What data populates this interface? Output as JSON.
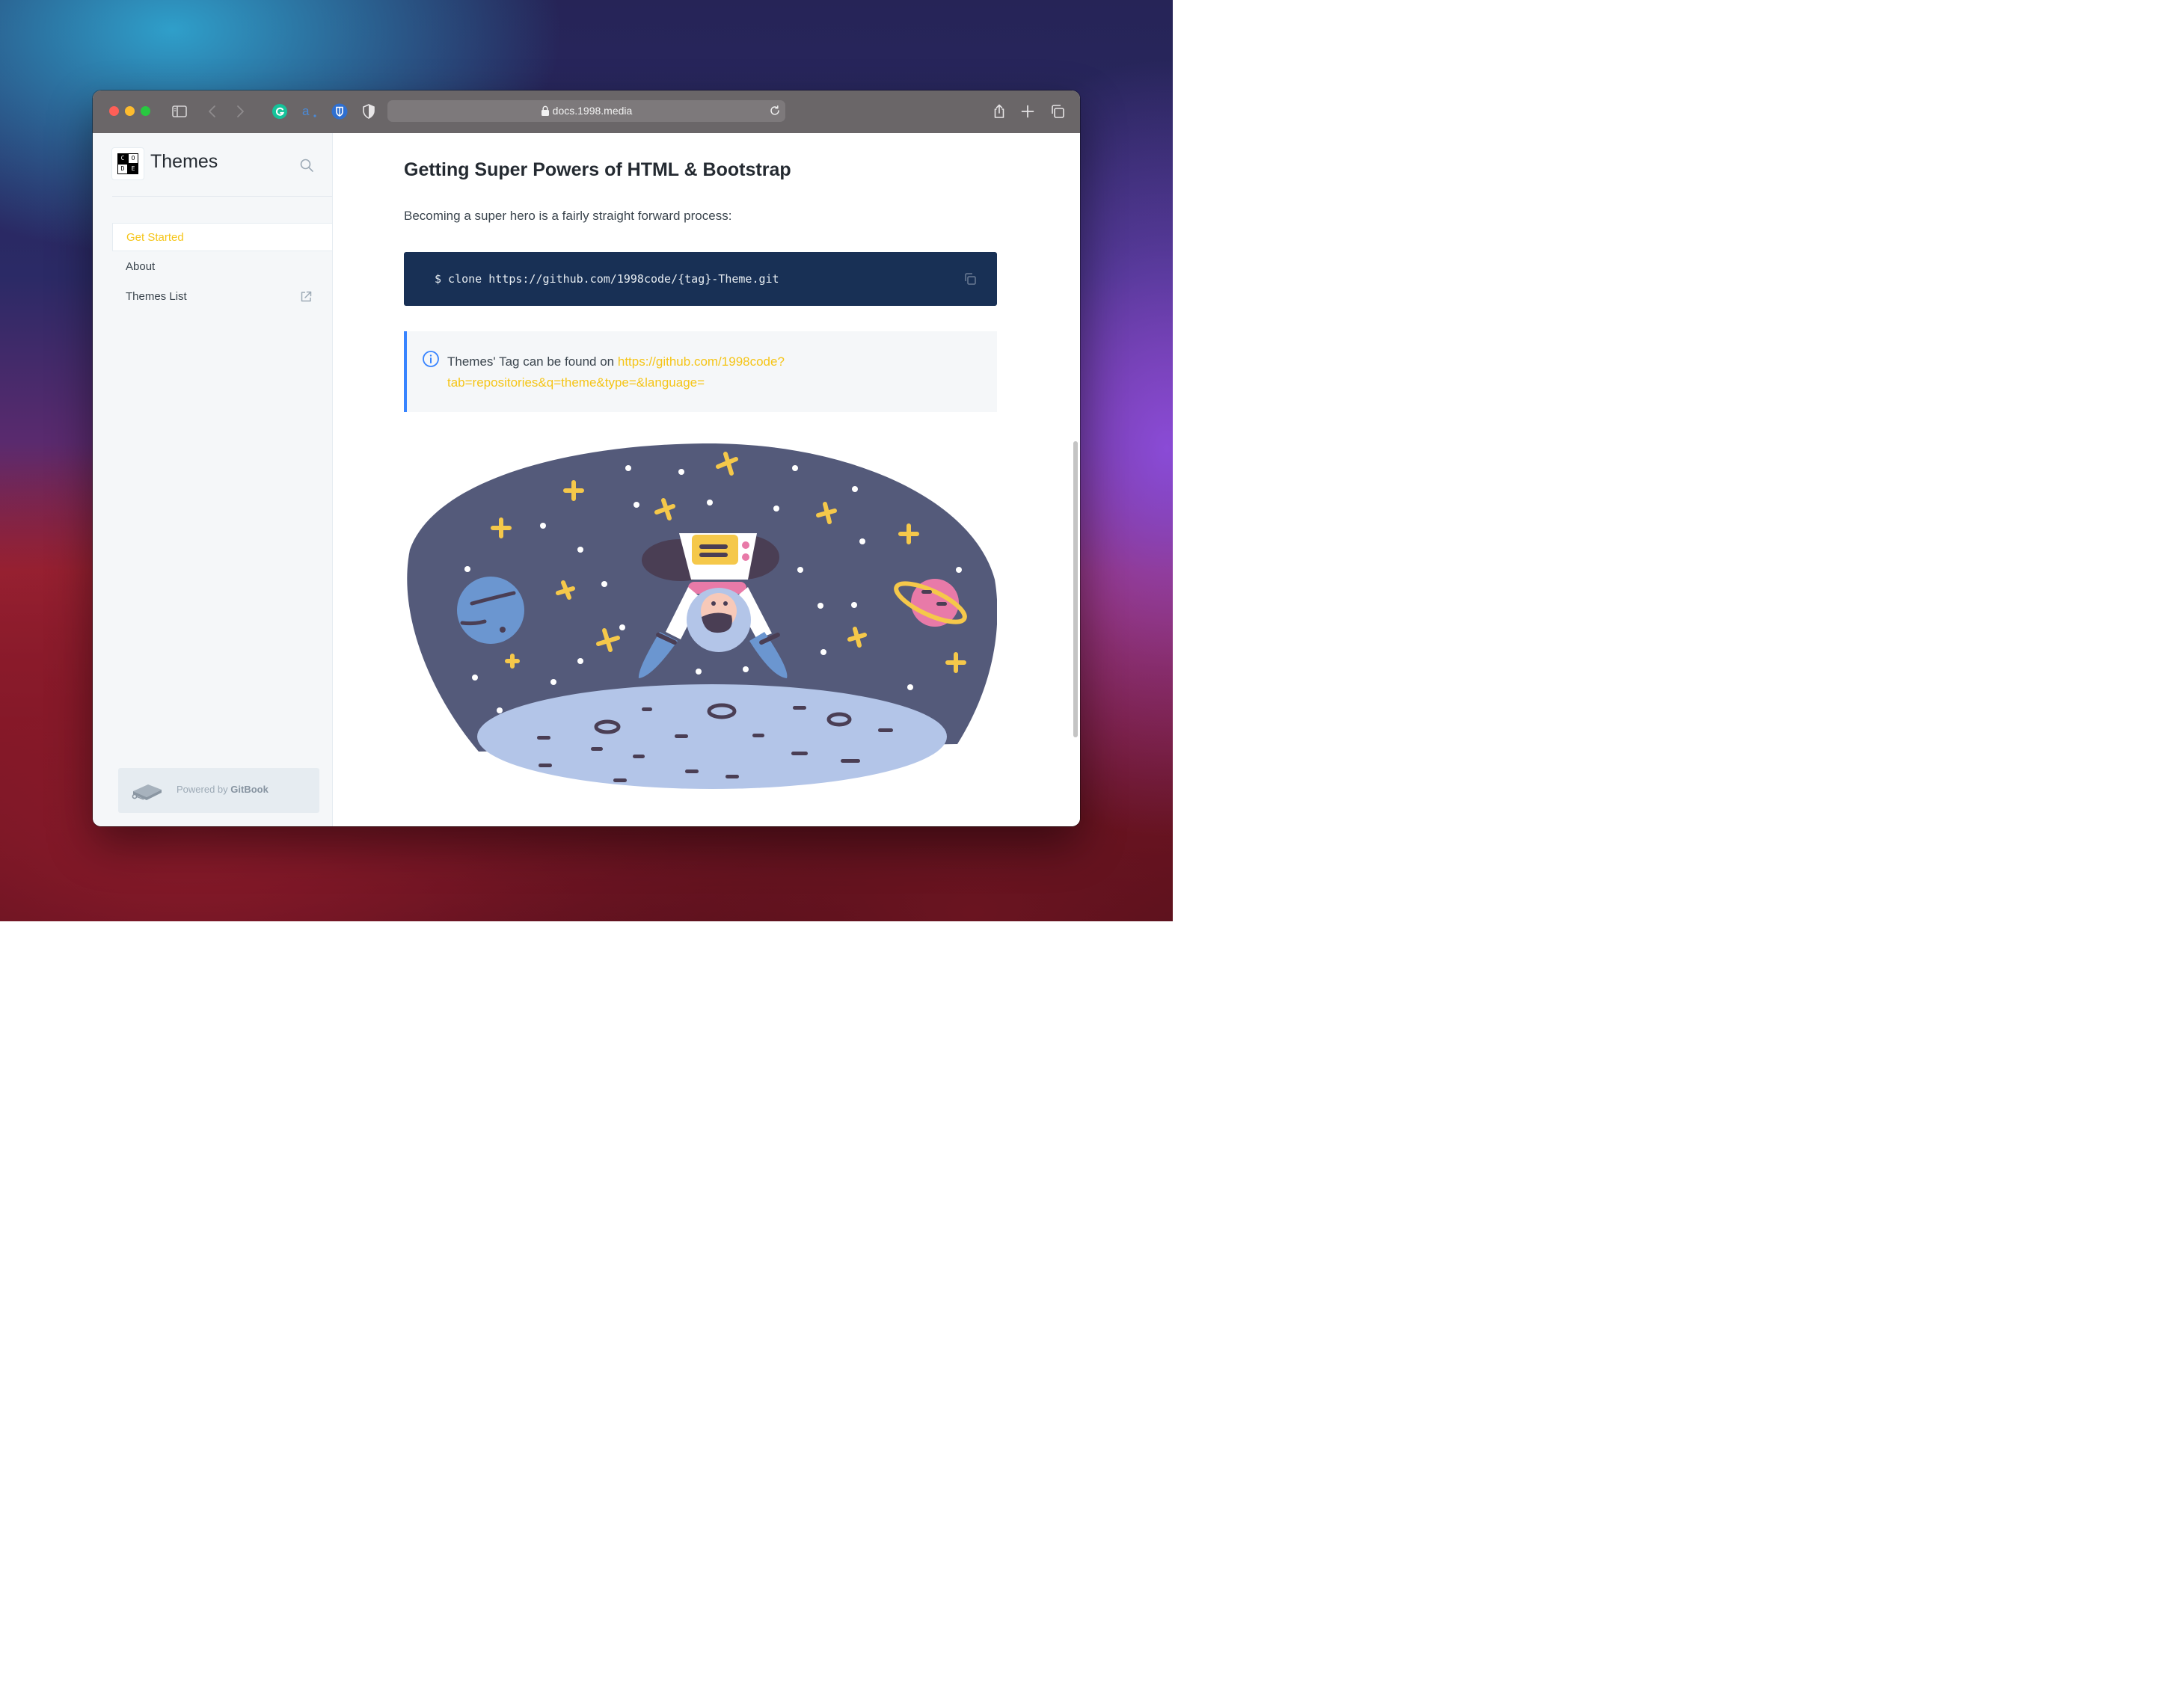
{
  "browser": {
    "url": "docs.1998.media"
  },
  "sidebar": {
    "logo_letters": [
      "C",
      "O",
      "D",
      "E"
    ],
    "site_title": "Themes",
    "items": [
      {
        "label": "Get Started",
        "active": true
      },
      {
        "label": "About",
        "active": false
      },
      {
        "label": "Themes List",
        "active": false,
        "external": true
      }
    ],
    "powered_prefix": "Powered by ",
    "powered_brand": "GitBook"
  },
  "main": {
    "heading": "Getting Super Powers of HTML & Bootstrap",
    "paragraph": "Becoming a super hero is a fairly straight forward process:",
    "code": "$ clone https://github.com/1998code/{tag}-Theme.git",
    "hint_text": "Themes' Tag can be found on ",
    "hint_link": "https://github.com/1998code?tab=repositories&q=theme&type=&language="
  },
  "colors": {
    "accent": "#f5c518",
    "hint_border": "#3884ff",
    "code_bg": "#183055"
  },
  "icons": [
    "sidebar-icon",
    "back-icon",
    "forward-icon",
    "grammarly-icon",
    "amazon-icon",
    "bitwarden-icon",
    "privacy-shield-icon",
    "lock-icon",
    "reload-icon",
    "share-icon",
    "new-tab-icon",
    "tab-overview-icon",
    "search-icon",
    "external-link-icon",
    "copy-icon",
    "info-icon",
    "gitbook-icon"
  ]
}
